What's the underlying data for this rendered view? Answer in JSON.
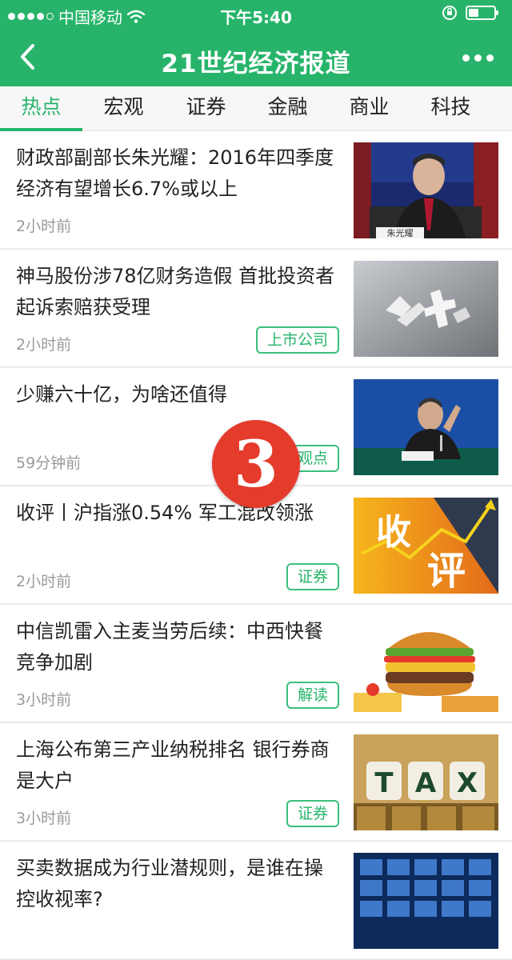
{
  "status_bar": {
    "carrier": "中国移动",
    "time": "下午5:40"
  },
  "header": {
    "title": "21世纪经济报道"
  },
  "tabs": [
    {
      "label": "热点",
      "active": true
    },
    {
      "label": "宏观",
      "active": false
    },
    {
      "label": "证券",
      "active": false
    },
    {
      "label": "金融",
      "active": false
    },
    {
      "label": "商业",
      "active": false
    },
    {
      "label": "科技",
      "active": false
    }
  ],
  "articles": [
    {
      "headline": "财政部副部长朱光耀：2016年四季度经济有望增长6.7%或以上",
      "time": "2小时前",
      "tag": "",
      "thumb_caption": "朱光耀"
    },
    {
      "headline": "神马股份涉78亿财务造假 首批投资者起诉索赔获受理",
      "time": "2小时前",
      "tag": "上市公司"
    },
    {
      "headline": "少赚六十亿，为啥还值得",
      "time": "59分钟前",
      "tag": "观点"
    },
    {
      "headline": "收评丨沪指涨0.54% 军工混改领涨",
      "time": "2小时前",
      "tag": "证券",
      "thumb_text": [
        "收",
        "评"
      ]
    },
    {
      "headline": "中信凯雷入主麦当劳后续：中西快餐竞争加剧",
      "time": "3小时前",
      "tag": "解读"
    },
    {
      "headline": "上海公布第三产业纳税排名 银行券商是大户",
      "time": "3小时前",
      "tag": "证券",
      "thumb_text": [
        "T",
        "A",
        "X"
      ]
    },
    {
      "headline": "买卖数据成为行业潜规则，是谁在操控收视率?",
      "time": "",
      "tag": ""
    }
  ],
  "overlay_badge": "3",
  "colors": {
    "brand_green": "#27b46a",
    "badge_red": "#e53b2c"
  }
}
